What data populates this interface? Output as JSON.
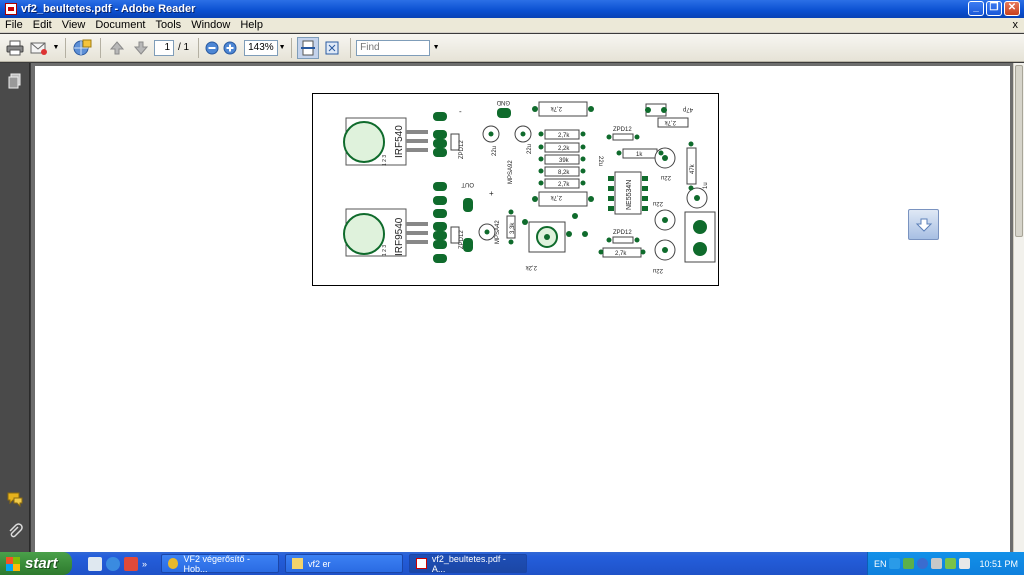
{
  "window": {
    "title": "vf2_beultetes.pdf - Adobe Reader",
    "minimize": "_",
    "maximize": "❐",
    "close": "✕"
  },
  "menu": {
    "items": [
      "File",
      "Edit",
      "View",
      "Document",
      "Tools",
      "Window",
      "Help"
    ],
    "doc_close": "x"
  },
  "toolbar": {
    "page_current": "1",
    "page_total": "/ 1",
    "zoom": "143%",
    "find_placeholder": "Find"
  },
  "pcb": {
    "labels": {
      "irf540": "IRF540",
      "irf9540": "IRF9540",
      "pins_a": "1 2 3",
      "pins_b": "1 2 3",
      "zpd12_a": "ZPD12",
      "zpd12_b": "ZPD12",
      "zpd12_c": "ZPD12",
      "zpd12_d": "ZPD12",
      "gnd": "GND",
      "out": "OUT",
      "minus": "-",
      "plus": "+",
      "mpsa92": "MPSA92",
      "mpsa42": "MPSA42",
      "r27k_1": "2,7k",
      "r27k_2": "2,7k",
      "r27k_3": "2,7k",
      "r27k_4": "2,7k",
      "r27k_5": "2,7k",
      "r27k_6": "2,7k",
      "r22k": "2,2k",
      "r39k": "39k",
      "r82k": "8,2k",
      "r1k": "1k",
      "r47k": "47k",
      "r33k": "3,3k",
      "c22u_1": "22u",
      "c22u_2": "22u",
      "c22u_3": "22u",
      "c22u_4": "22u",
      "c22u_5": "22u",
      "c47p": "47p",
      "c1u": "1u",
      "ic": "NE5534N"
    }
  },
  "taskbar": {
    "start": "start",
    "tasks": [
      "VF2 végerősítő - Hob...",
      "vf2 er",
      "vf2_beultetes.pdf - A..."
    ],
    "lang": "EN",
    "clock": "10:51 PM"
  },
  "colors": {
    "xp_blue": "#0a4fd0",
    "pcb_green": "#0f6b2c",
    "reader_dark": "#3b3b3b"
  }
}
